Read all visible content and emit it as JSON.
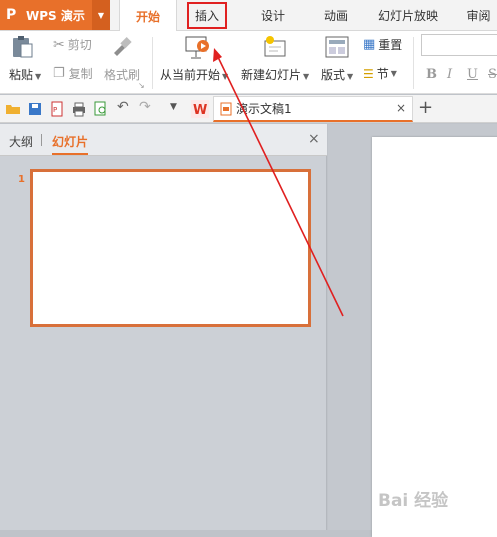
{
  "app": {
    "logo": "P",
    "name": "WPS 演示"
  },
  "tabs": [
    {
      "label": "开始",
      "state": "active"
    },
    {
      "label": "插入",
      "state": "highlighted"
    },
    {
      "label": "设计"
    },
    {
      "label": "动画"
    },
    {
      "label": "幻灯片放映"
    },
    {
      "label": "审阅"
    }
  ],
  "ribbon": {
    "paste": "粘贴",
    "cut": "剪切",
    "copy": "复制",
    "format_painter": "格式刷",
    "from_current": "从当前开始",
    "new_slide": "新建幻灯片",
    "layout": "版式",
    "reset": "重置",
    "section": "节",
    "format_buttons": [
      "B",
      "I",
      "U",
      "S"
    ]
  },
  "document": {
    "tab_title": "演示文稿1",
    "close": "×",
    "new": "+"
  },
  "panel": {
    "tab_outline": "大纲",
    "tab_slides": "幻灯片",
    "close": "×",
    "slide_number": "1"
  },
  "watermark": "Bai 经验",
  "colors": {
    "accent": "#e8702a",
    "highlight_box": "#e02020",
    "arrow": "#e02020"
  }
}
